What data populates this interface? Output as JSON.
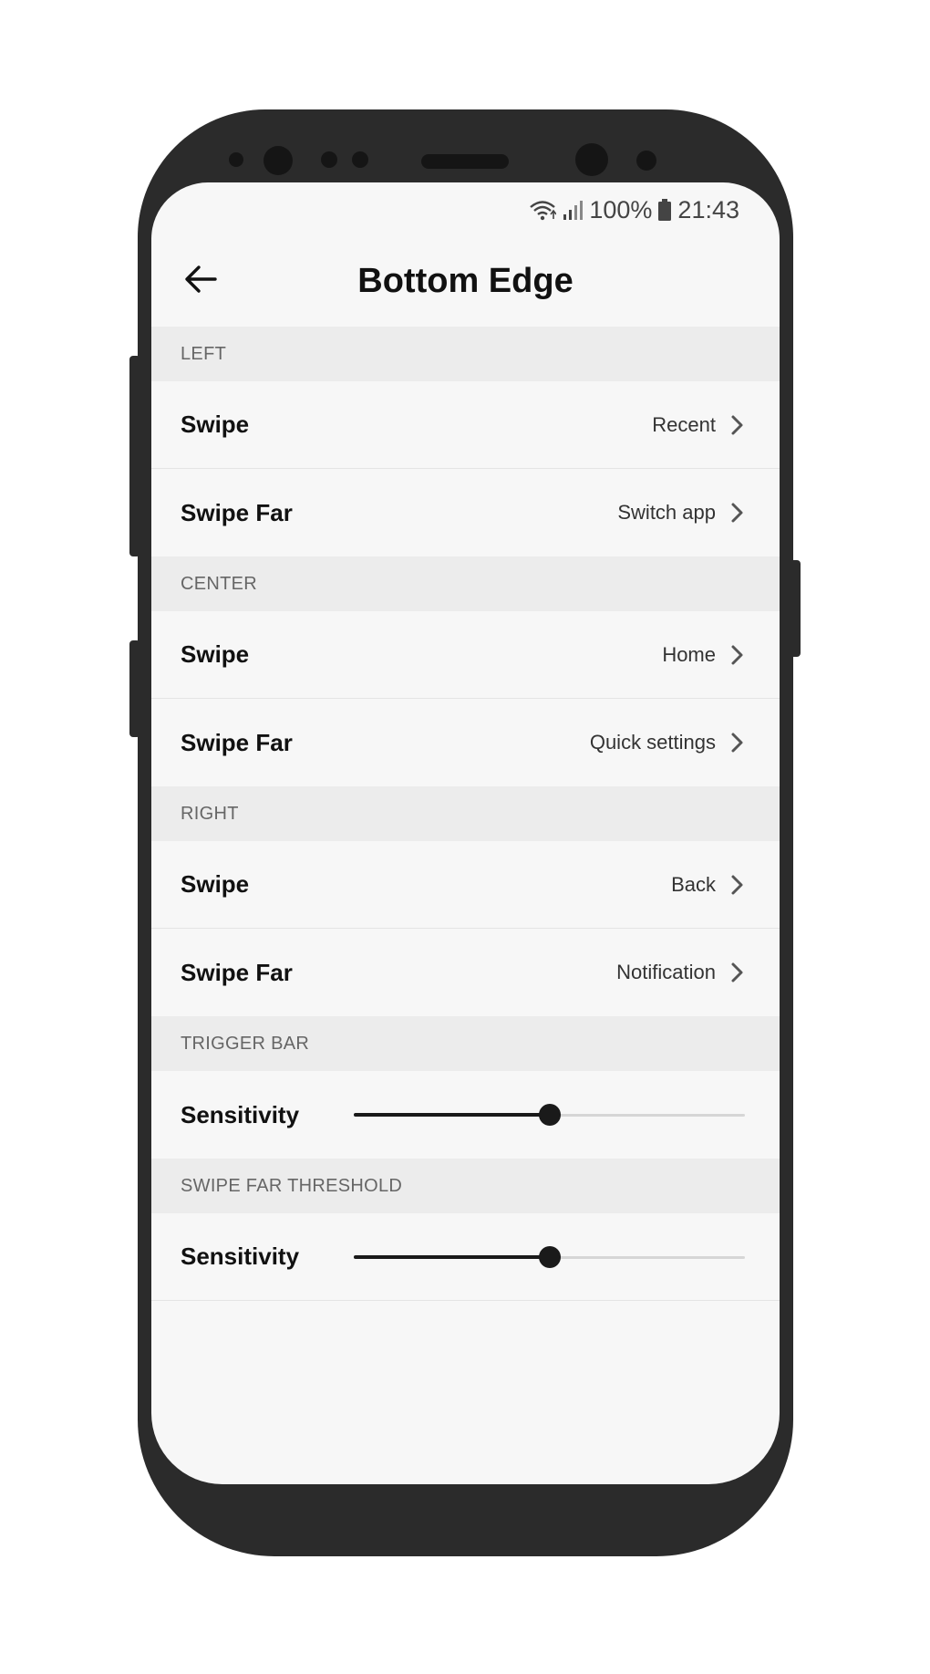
{
  "status_bar": {
    "battery": "100%",
    "time": "21:43",
    "icons": [
      "wifi-icon",
      "signal-icon",
      "battery-icon"
    ]
  },
  "header": {
    "title": "Bottom Edge",
    "back_icon": "arrow-left-icon"
  },
  "sections": [
    {
      "header": "LEFT",
      "rows": [
        {
          "label": "Swipe",
          "value": "Recent"
        },
        {
          "label": "Swipe Far",
          "value": "Switch app"
        }
      ]
    },
    {
      "header": "CENTER",
      "rows": [
        {
          "label": "Swipe",
          "value": "Home"
        },
        {
          "label": "Swipe Far",
          "value": "Quick settings"
        }
      ]
    },
    {
      "header": "RIGHT",
      "rows": [
        {
          "label": "Swipe",
          "value": "Back"
        },
        {
          "label": "Swipe Far",
          "value": "Notification"
        }
      ]
    },
    {
      "header": "TRIGGER BAR",
      "slider": {
        "label": "Sensitivity",
        "level": 0.5
      }
    },
    {
      "header": "SWIPE FAR THRESHOLD",
      "slider": {
        "label": "Sensitivity",
        "level": 0.5
      }
    }
  ],
  "colors": {
    "accent": "#1a1a1a",
    "screen_bg": "#f7f7f7",
    "section_bg": "#ececec",
    "phone_body": "#2b2b2b"
  }
}
